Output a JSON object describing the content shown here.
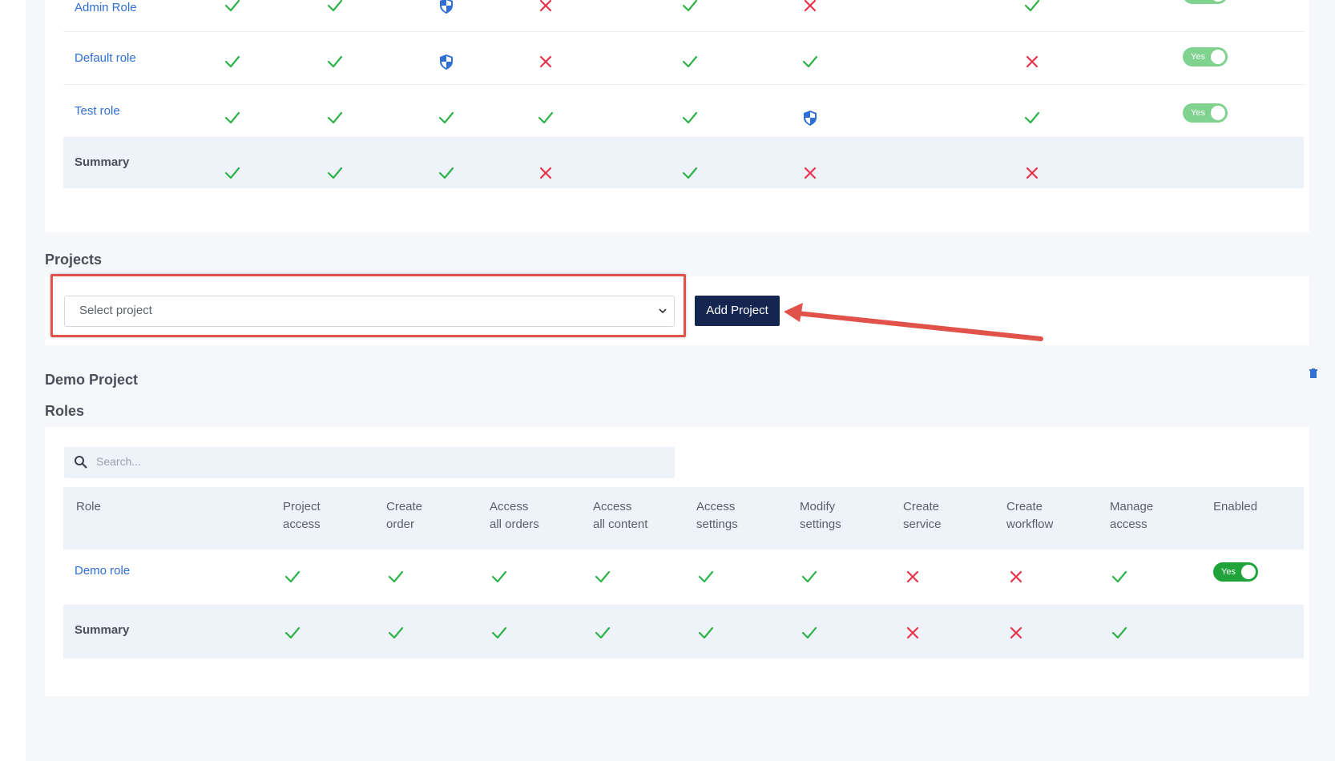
{
  "top_table": {
    "rows": [
      {
        "role": "Admin Role",
        "cells": [
          "check",
          "check",
          "shield",
          "cross",
          "check",
          "cross",
          "check"
        ],
        "enabled": "Yes"
      },
      {
        "role": "Default role",
        "cells": [
          "check",
          "check",
          "shield",
          "cross",
          "check",
          "check",
          "cross"
        ],
        "enabled": "Yes"
      },
      {
        "role": "Test role",
        "cells": [
          "check",
          "check",
          "check",
          "check",
          "check",
          "shield",
          "check"
        ],
        "enabled": "Yes"
      }
    ],
    "summary": {
      "label": "Summary",
      "cells": [
        "check",
        "check",
        "check",
        "cross",
        "check",
        "cross",
        "cross"
      ]
    }
  },
  "projects": {
    "title": "Projects",
    "select_placeholder": "Select project",
    "add_button": "Add Project"
  },
  "demo_project": {
    "title": "Demo Project",
    "roles_title": "Roles",
    "search_placeholder": "Search...",
    "headers": [
      [
        "Role",
        ""
      ],
      [
        "Project",
        "access"
      ],
      [
        "Create",
        "order"
      ],
      [
        "Access",
        "all orders"
      ],
      [
        "Access",
        "all content"
      ],
      [
        "Access",
        "settings"
      ],
      [
        "Modify",
        "settings"
      ],
      [
        "Create",
        "service"
      ],
      [
        "Create",
        "workflow"
      ],
      [
        "Manage",
        "access"
      ],
      [
        "Enabled",
        ""
      ]
    ],
    "rows": [
      {
        "role": "Demo role",
        "cells": [
          "check",
          "check",
          "check",
          "check",
          "check",
          "check",
          "cross",
          "cross",
          "check"
        ],
        "enabled": "Yes"
      }
    ],
    "summary": {
      "label": "Summary",
      "cells": [
        "check",
        "check",
        "check",
        "check",
        "check",
        "check",
        "cross",
        "cross",
        "check"
      ]
    }
  },
  "colors": {
    "check": "#2fb24a",
    "cross": "#e8334a",
    "shield": "#2f6fd6",
    "button": "#14264f",
    "link": "#2f6fd6"
  }
}
